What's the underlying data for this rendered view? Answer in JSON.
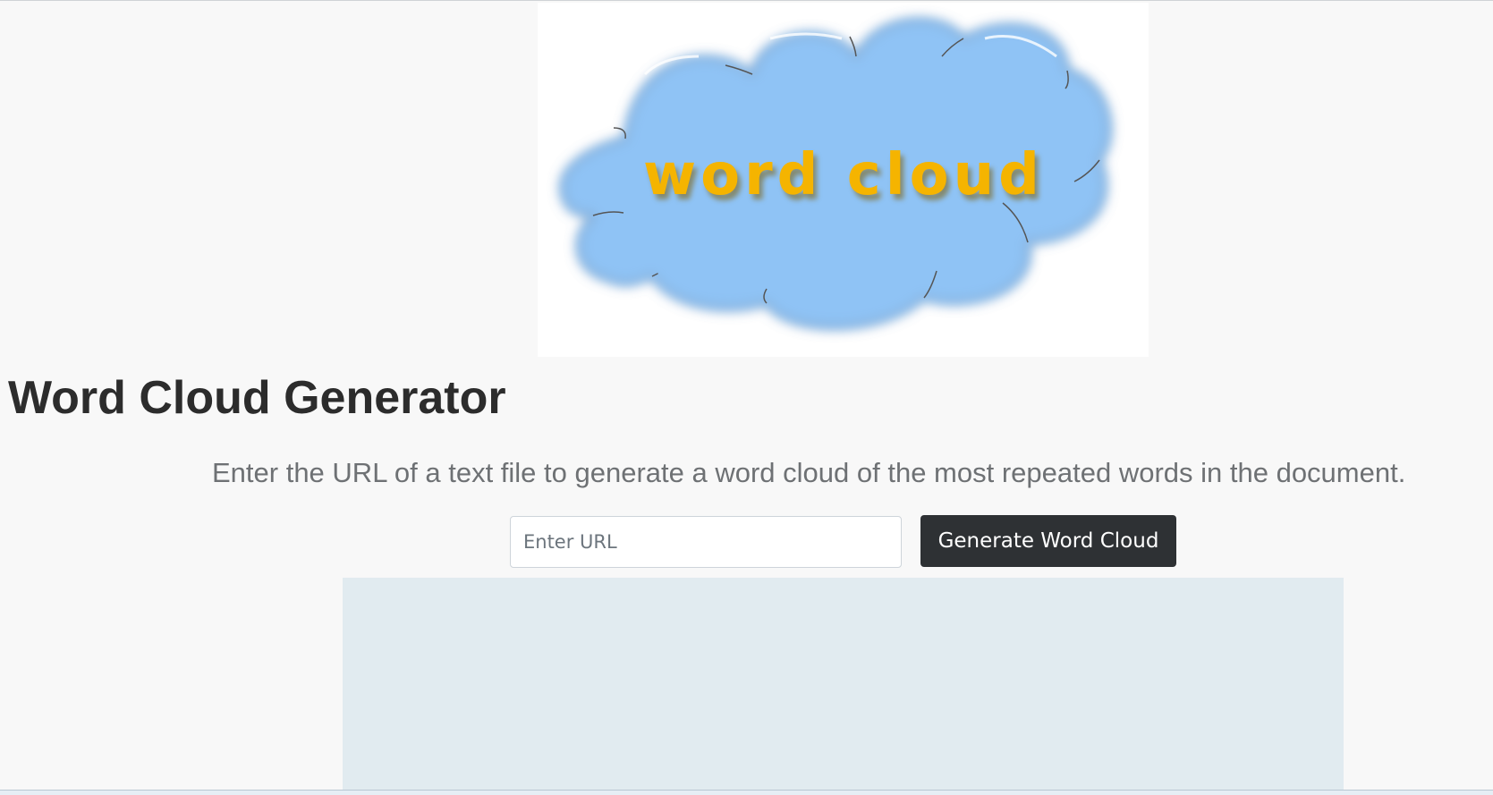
{
  "header": {
    "logo_text": "word cloud",
    "title": "Word Cloud Generator",
    "subtitle": "Enter the URL of a text file to generate a word cloud of the most repeated words in the document."
  },
  "form": {
    "url_placeholder": "Enter URL",
    "url_value": "",
    "generate_label": "Generate Word Cloud"
  },
  "colors": {
    "background": "#f8f8f8",
    "button": "#2e3134",
    "output_area": "#e1ebf0",
    "logo_text": "#f5b400",
    "cloud_fill": "#c9c9c9"
  }
}
